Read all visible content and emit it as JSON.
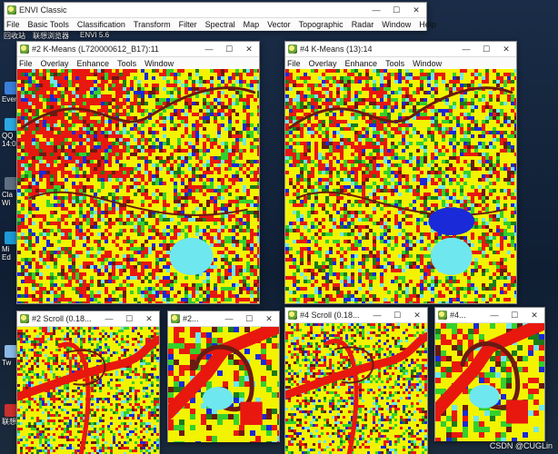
{
  "desktop": {
    "icons": [
      {
        "label": "Ever"
      },
      {
        "label": "QQ 14:0"
      },
      {
        "label": "Cla Wi"
      },
      {
        "label": "Mi Ed"
      },
      {
        "label": "Tw"
      },
      {
        "label": "联想"
      }
    ],
    "top_labels": [
      "回收站",
      "联想浏览器",
      "ENVI 5.6"
    ]
  },
  "envi_main": {
    "title": "ENVI Classic",
    "menu": [
      "File",
      "Basic Tools",
      "Classification",
      "Transform",
      "Filter",
      "Spectral",
      "Map",
      "Vector",
      "Topographic",
      "Radar",
      "Window",
      "Help"
    ]
  },
  "image_windows": [
    {
      "title": "#2 K-Means (L720000612_B17):11",
      "menu": [
        "File",
        "Overlay",
        "Enhance",
        "Tools",
        "Window"
      ]
    },
    {
      "title": "#4 K-Means (13):14",
      "menu": [
        "File",
        "Overlay",
        "Enhance",
        "Tools",
        "Window"
      ]
    }
  ],
  "small_windows": [
    {
      "title": "#2 Scroll (0.18..."
    },
    {
      "title": "#2..."
    },
    {
      "title": "#4 Scroll (0.18..."
    },
    {
      "title": "#4..."
    }
  ],
  "window_controls": {
    "minimize": "—",
    "maximize": "☐",
    "close": "✕"
  },
  "watermark": "CSDN @CUGLin",
  "class_colors": {
    "red": "#e8180f",
    "yellow": "#f3f300",
    "green": "#35d02c",
    "dark_green": "#1c7a1a",
    "blue": "#1a2ad8",
    "cyan": "#6fe7ef",
    "maroon": "#6b1a12"
  }
}
